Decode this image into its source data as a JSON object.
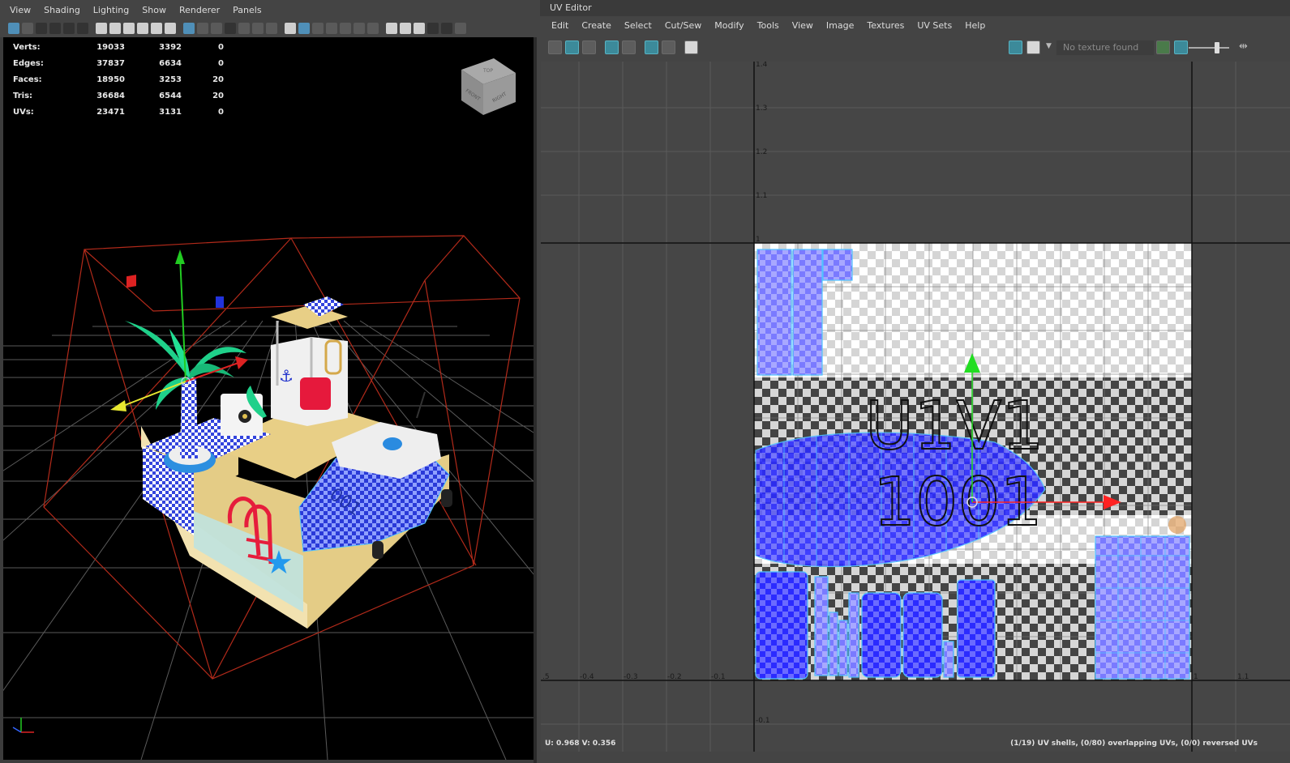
{
  "viewport": {
    "menu": [
      "View",
      "Shading",
      "Lighting",
      "Show",
      "Renderer",
      "Panels"
    ],
    "hud": [
      {
        "label": "Verts:",
        "a": "19033",
        "b": "3392",
        "c": "0"
      },
      {
        "label": "Edges:",
        "a": "37837",
        "b": "6634",
        "c": "0"
      },
      {
        "label": "Faces:",
        "a": "18950",
        "b": "3253",
        "c": "20"
      },
      {
        "label": "Tris:",
        "a": "36684",
        "b": "6544",
        "c": "20"
      },
      {
        "label": "UVs:",
        "a": "23471",
        "b": "3131",
        "c": "0"
      }
    ],
    "viewcube": {
      "front": "FRONT",
      "right": "RIGHT",
      "top": "TOP"
    },
    "boat_text": "001",
    "colors": {
      "background": "#000000",
      "grid": "#5a5a5a",
      "bbox": "#b22a1a",
      "checker_blue": "#3344dd",
      "palm": "#1fd08a",
      "sand": "#e4cc86"
    }
  },
  "uv_editor": {
    "title": "UV Editor",
    "menu": [
      "Edit",
      "Create",
      "Select",
      "Cut/Sew",
      "Modify",
      "Tools",
      "View",
      "Image",
      "Textures",
      "UV Sets",
      "Help"
    ],
    "texture_field": "No texture found",
    "grid_labels_v": [
      "1.4",
      "1.3",
      "1.2",
      "1.1",
      "1",
      "-0.1"
    ],
    "grid_labels_u": [
      ".5",
      "-0.4",
      "-0.3",
      "-0.2",
      "-0.1",
      "1",
      "1.1"
    ],
    "tile_label_top": "U1V1",
    "tile_label_bottom": "1001",
    "coord_readout": "U:  0.968  V:  0.356",
    "status": "(1/19) UV shells, (0/80) overlapping UVs, (0/0) reversed UVs",
    "colors": {
      "canvas": "#464646",
      "shell_fill": "#2323e0",
      "shell_edge": "#4fc3ff",
      "manip_u": "#ff2222",
      "manip_v": "#22dd22"
    }
  }
}
